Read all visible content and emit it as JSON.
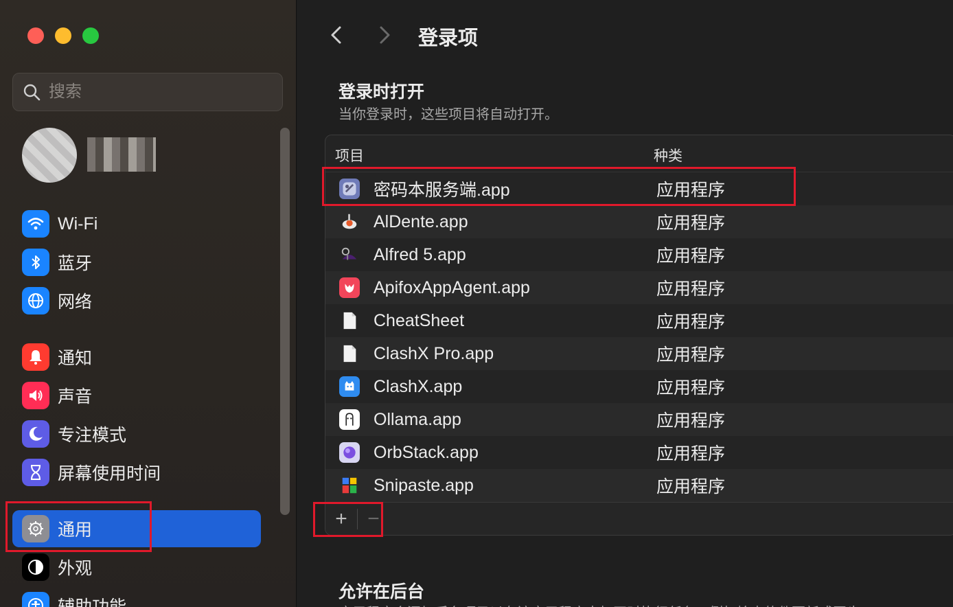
{
  "sidebar": {
    "search_placeholder": "搜索",
    "items": [
      {
        "label": "Wi-Fi",
        "icon": "wifi-icon",
        "color": "#1a84ff"
      },
      {
        "label": "蓝牙",
        "icon": "bluetooth-icon",
        "color": "#1a84ff"
      },
      {
        "label": "网络",
        "icon": "globe-icon",
        "color": "#1a84ff"
      },
      {
        "label": "通知",
        "icon": "bell-icon",
        "color": "#ff3b30"
      },
      {
        "label": "声音",
        "icon": "speaker-icon",
        "color": "#ff2d55"
      },
      {
        "label": "专注模式",
        "icon": "moon-icon",
        "color": "#5e5ce6"
      },
      {
        "label": "屏幕使用时间",
        "icon": "hourglass-icon",
        "color": "#5e5ce6"
      },
      {
        "label": "通用",
        "icon": "gear-icon",
        "color": "#8e8e93",
        "active": true
      },
      {
        "label": "外观",
        "icon": "appearance-icon",
        "color": "#000000"
      },
      {
        "label": "辅助功能",
        "icon": "accessibility-icon",
        "color": "#1a84ff"
      }
    ]
  },
  "main": {
    "title": "登录项",
    "section1": {
      "title": "登录时打开",
      "subtitle": "当你登录时，这些项目将自动打开。"
    },
    "table": {
      "col_item": "项目",
      "col_kind": "种类",
      "rows": [
        {
          "name": "密码本服务端.app",
          "kind": "应用程序",
          "icon": "password-app-icon"
        },
        {
          "name": "AlDente.app",
          "kind": "应用程序",
          "icon": "aldente-icon"
        },
        {
          "name": "Alfred 5.app",
          "kind": "应用程序",
          "icon": "alfred-icon"
        },
        {
          "name": "ApifoxAppAgent.app",
          "kind": "应用程序",
          "icon": "apifox-icon"
        },
        {
          "name": "CheatSheet",
          "kind": "应用程序",
          "icon": "document-icon"
        },
        {
          "name": "ClashX Pro.app",
          "kind": "应用程序",
          "icon": "document-icon"
        },
        {
          "name": "ClashX.app",
          "kind": "应用程序",
          "icon": "clashx-icon"
        },
        {
          "name": "Ollama.app",
          "kind": "应用程序",
          "icon": "ollama-icon"
        },
        {
          "name": "OrbStack.app",
          "kind": "应用程序",
          "icon": "orbstack-icon"
        },
        {
          "name": "Snipaste.app",
          "kind": "应用程序",
          "icon": "snipaste-icon"
        }
      ],
      "add_label": "+",
      "remove_label": "−"
    },
    "section2": {
      "title": "允许在后台",
      "subtitle": "应用程序会添加后台项目以在该应用程序未打开时执行任务，例如检查软件更新或同步"
    }
  },
  "colors": {
    "accent": "#1f62d8",
    "highlight": "#e0192b"
  }
}
